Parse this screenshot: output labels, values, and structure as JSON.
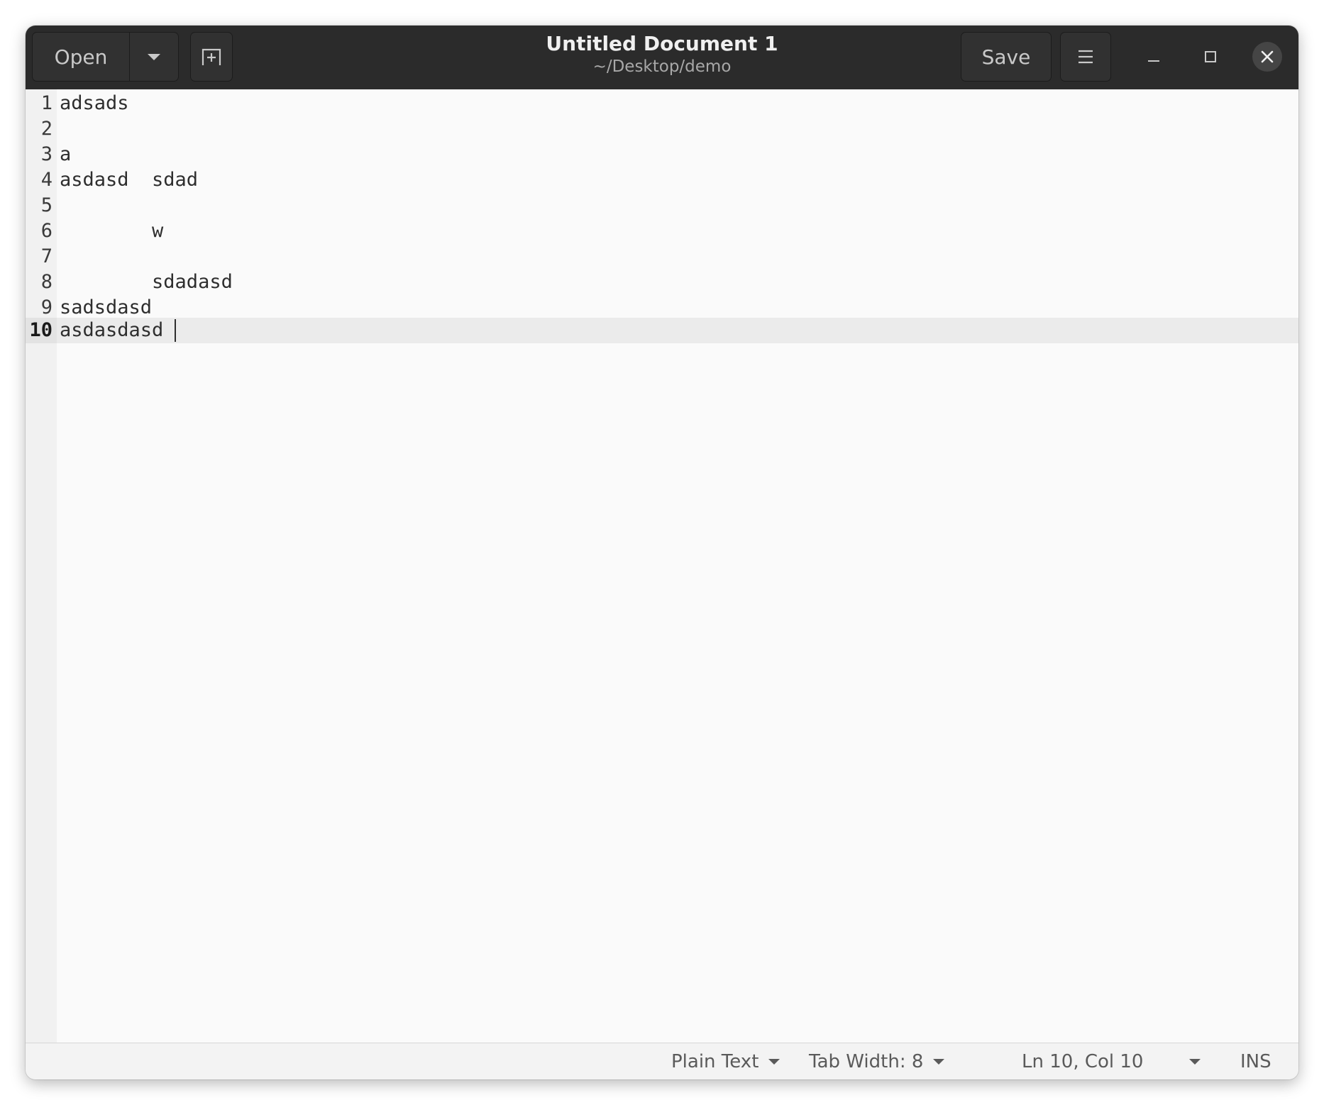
{
  "window": {
    "title": "Untitled Document 1",
    "subtitle": "~/Desktop/demo"
  },
  "toolbar": {
    "open_label": "Open",
    "save_label": "Save",
    "open_menu_icon": "chevron-down-icon",
    "new_tab_icon": "new-tab-icon",
    "menu_icon": "hamburger-menu-icon",
    "minimize_icon": "minimize-icon",
    "maximize_icon": "maximize-icon",
    "close_icon": "close-icon"
  },
  "editor": {
    "current_line": 10,
    "lines": [
      {
        "number": "1",
        "text": "adsads"
      },
      {
        "number": "2",
        "text": ""
      },
      {
        "number": "3",
        "text": "a"
      },
      {
        "number": "4",
        "text": "asdasd  sdad"
      },
      {
        "number": "5",
        "text": ""
      },
      {
        "number": "6",
        "text": "        w"
      },
      {
        "number": "7",
        "text": ""
      },
      {
        "number": "8",
        "text": "        sdadasd"
      },
      {
        "number": "9",
        "text": "sadsdasd"
      },
      {
        "number": "10",
        "text": "asdasdasd"
      }
    ]
  },
  "statusbar": {
    "language": "Plain Text",
    "tab_width": "Tab Width: 8",
    "position": "Ln 10, Col 10",
    "mode": "INS"
  },
  "colors": {
    "headerbar": "#2b2b2b",
    "editor_bg": "#fafafa",
    "gutter_bg": "#f1f1f1",
    "current_line_bg": "#ebebeb",
    "statusbar_bg": "#f3f3f3"
  }
}
